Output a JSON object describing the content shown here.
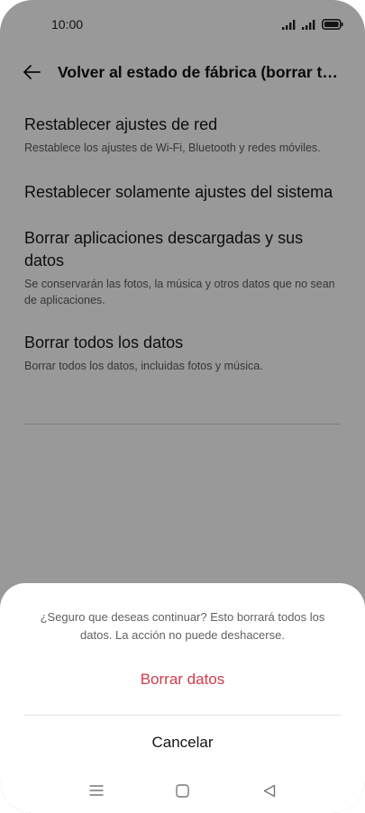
{
  "status_bar": {
    "time": "10:00"
  },
  "app_bar": {
    "title": "Volver al estado de fábrica (borrar todos los datos)"
  },
  "options": [
    {
      "title": "Restablecer ajustes de red",
      "subtitle": "Restablece los ajustes de Wi-Fi, Bluetooth y redes móviles."
    },
    {
      "title": "Restablecer solamente ajustes del sistema",
      "subtitle": ""
    },
    {
      "title": "Borrar aplicaciones descargadas y sus datos",
      "subtitle": "Se conservarán las fotos, la música y otros datos que no sean de aplicaciones."
    },
    {
      "title": "Borrar todos los datos",
      "subtitle": "Borrar todos los datos, incluidas fotos y música."
    }
  ],
  "dialog": {
    "message": "¿Seguro que deseas continuar? Esto borrará todos los datos. La acción no puede deshacerse.",
    "confirm_label": "Borrar datos",
    "cancel_label": "Cancelar"
  },
  "icons": {
    "back": "back-arrow-icon",
    "signal": "signal-icon",
    "battery": "battery-icon",
    "nav_menu": "menu-icon",
    "nav_home": "home-icon",
    "nav_back": "back-triangle-icon"
  },
  "colors": {
    "accent": "#d23b4a",
    "scrim": "rgba(0,0,0,0.40)"
  }
}
